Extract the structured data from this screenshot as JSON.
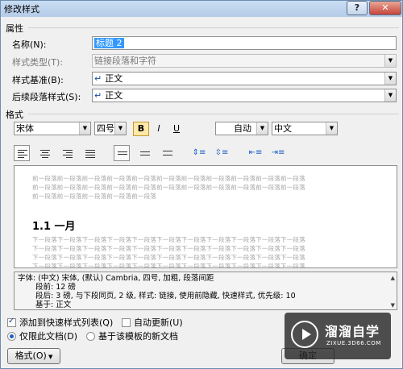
{
  "window": {
    "title": "修改样式",
    "help": "?",
    "close": "✕"
  },
  "properties": {
    "group_label": "属性",
    "name_label": "名称(N):",
    "name_value": "标题 2",
    "style_type_label": "样式类型(T):",
    "style_type_value": "链接段落和字符",
    "based_on_label": "样式基准(B):",
    "based_on_value": "正文",
    "next_style_label": "后续段落样式(S):",
    "next_style_value": "正文"
  },
  "formatting": {
    "group_label": "格式",
    "font": "宋体",
    "size": "四号",
    "bold": "B",
    "italic": "I",
    "underline": "U",
    "color": "自动",
    "script": "中文"
  },
  "preview": {
    "prev_line1": "前一段落前一段落前一段落前一段落前一段落前一段落前一段落前一段落前一段落前一段落前一段落",
    "prev_line2": "前一段落前一段落前一段落前一段落前一段落前一段落前一段落前一段落前一段落前一段落前一段落",
    "prev_line3": "前一段落前一段落前一段落前一段落前一段落",
    "heading": "1.1  一月",
    "next_line1": "下一段落下一段落下一段落下一段落下一段落下一段落下一段落下一段落下一段落下一段落下一段落",
    "next_line2": "下一段落下一段落下一段落下一段落下一段落下一段落下一段落下一段落下一段落下一段落下一段落",
    "next_line3": "下一段落下一段落下一段落下一段落下一段落下一段落下一段落下一段落下一段落下一段落下一段落",
    "next_line4": "下一段落下一段落下一段落下一段落下一段落下一段落下一段落下一段落下一段落下一段落下一段落"
  },
  "description": {
    "line1": "字体: (中文) 宋体, (默认) Cambria, 四号, 加粗, 段落间距",
    "line2": "段前: 12 磅",
    "line3": "段后: 3 磅, 与下段同页, 2 级, 样式: 链接, 使用前隐藏, 快速样式, 优先级: 10",
    "line4": "基于: 正文"
  },
  "options": {
    "add_quick_list": "添加到快速样式列表(Q)",
    "auto_update": "自动更新(U)",
    "only_this_doc": "仅限此文档(D)",
    "new_docs": "基于该模板的新文档"
  },
  "buttons": {
    "format": "格式(O)",
    "ok": "确定"
  },
  "watermark": {
    "title": "溜溜自学",
    "subtitle": "ZIXUE.3D66.COM"
  }
}
